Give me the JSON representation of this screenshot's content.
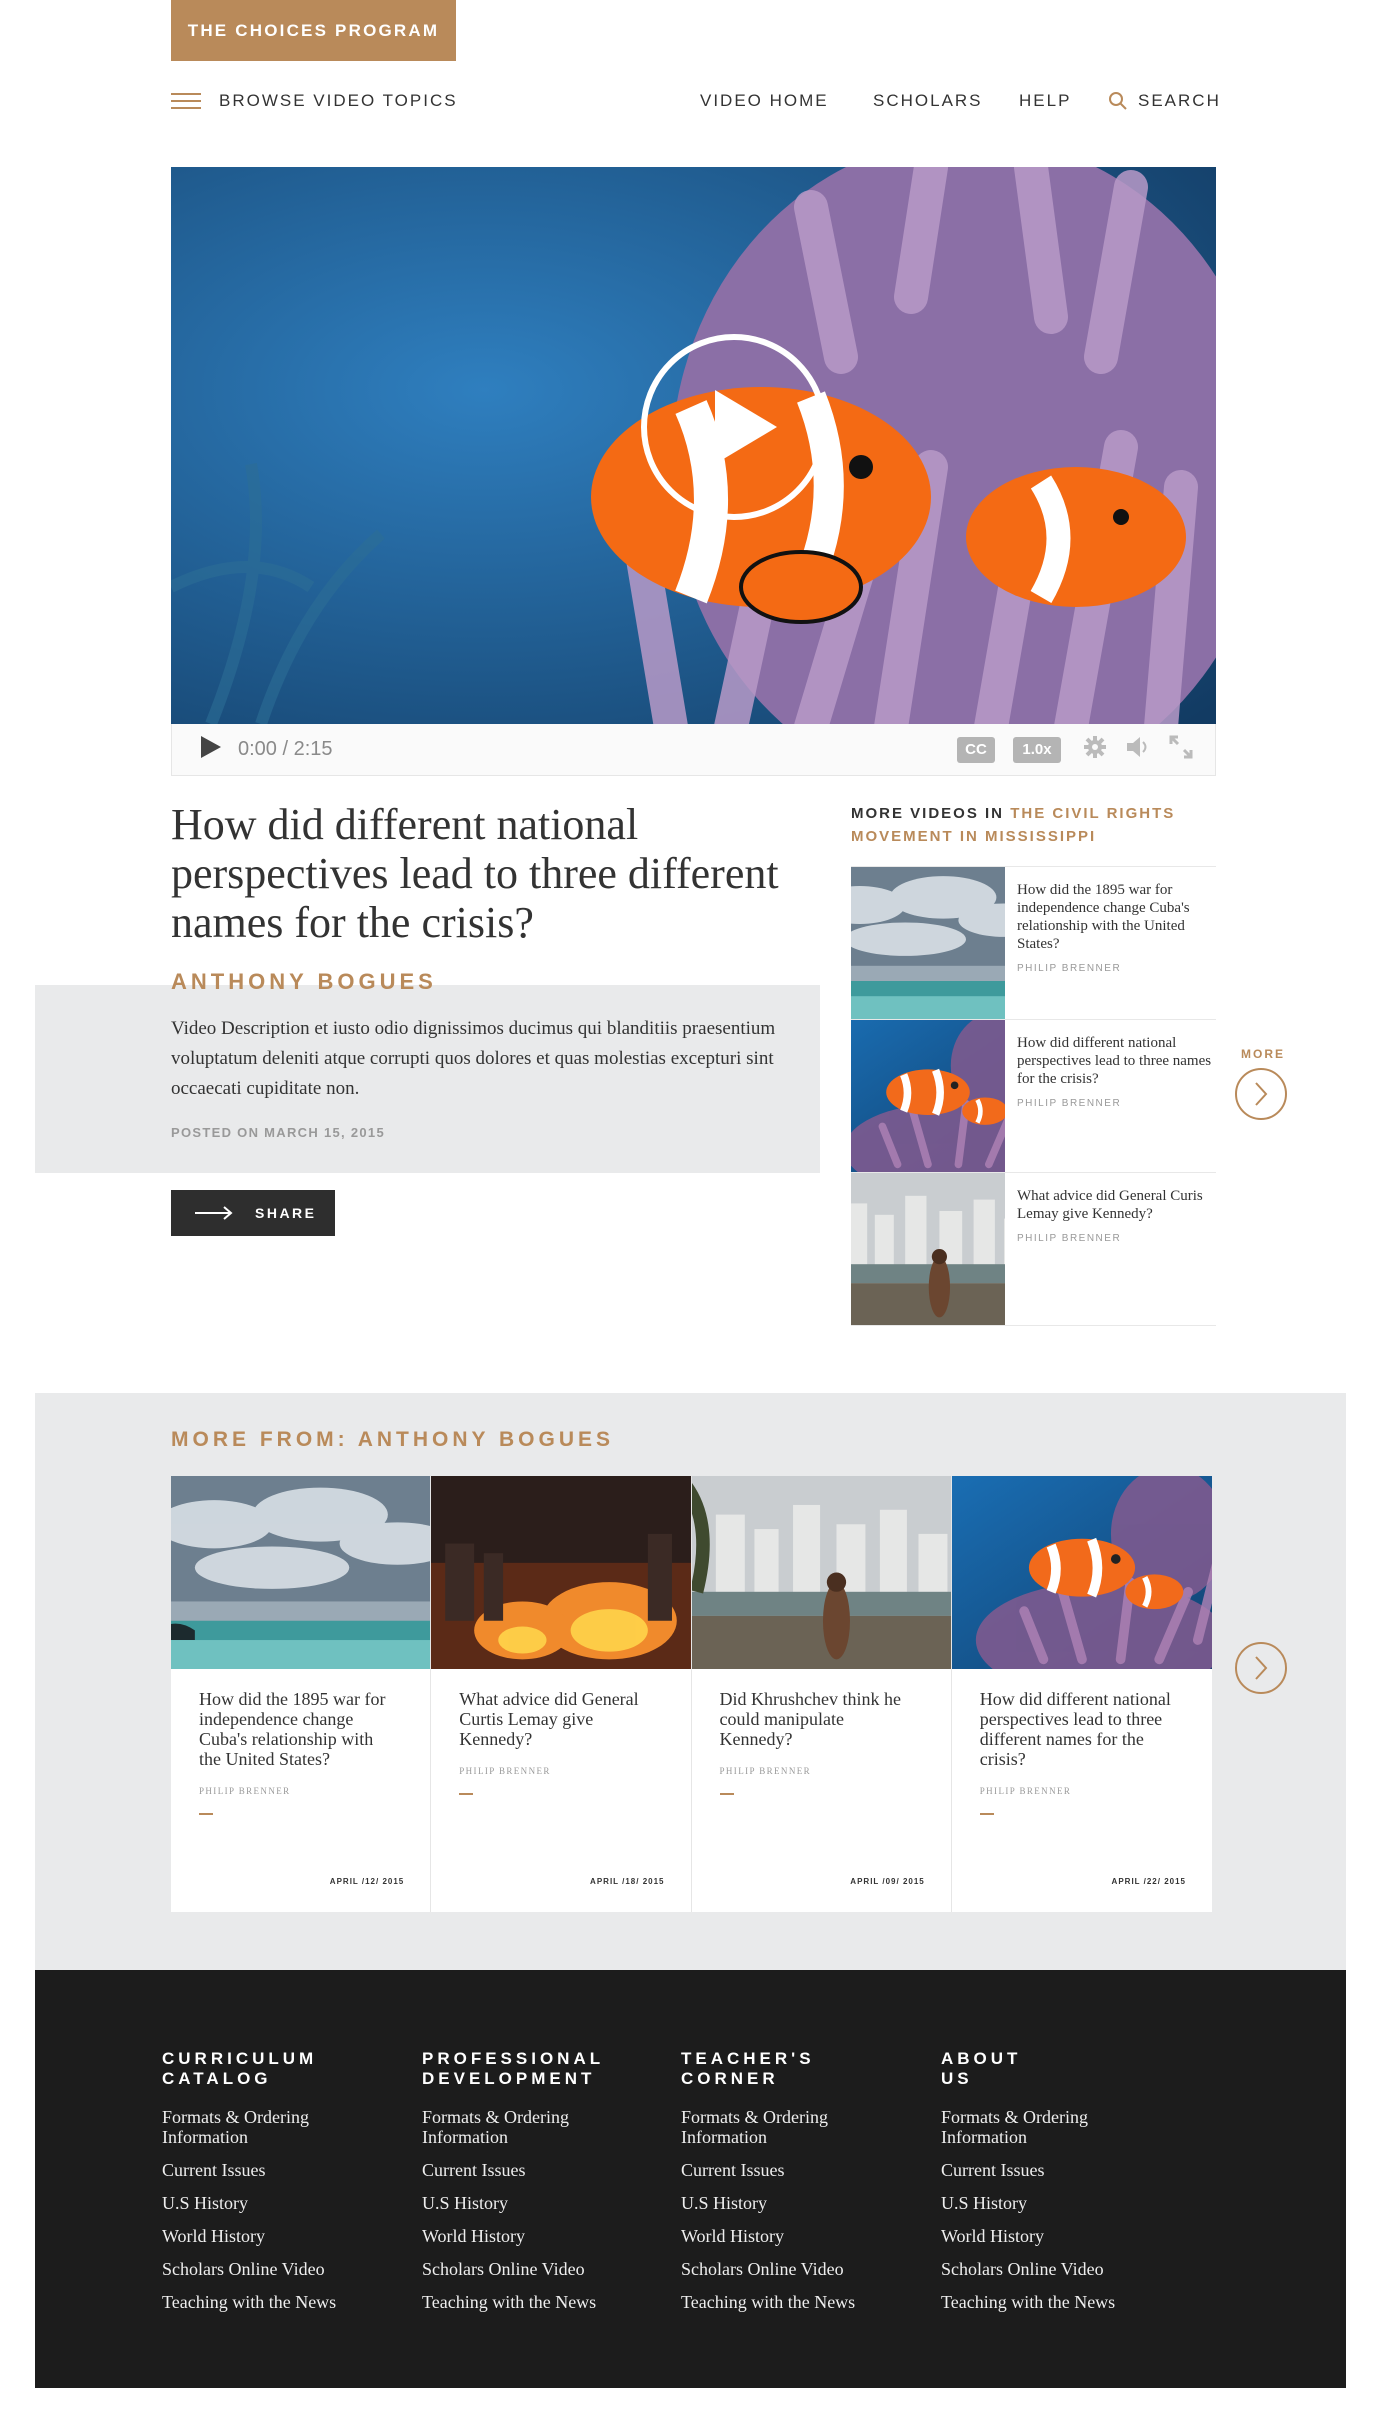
{
  "header": {
    "brand": "THE CHOICES PROGRAM",
    "browse": "BROWSE VIDEO TOPICS",
    "nav": [
      "VIDEO HOME",
      "SCHOLARS",
      "HELP"
    ],
    "search": "SEARCH"
  },
  "player": {
    "time": "0:00 / 2:15",
    "cc": "CC",
    "speed": "1.0x"
  },
  "article": {
    "title": "How did different national perspectives lead to three different names for the crisis?",
    "author": "ANTHONY BOGUES",
    "description": "Video Description et iusto odio dignissimos ducimus qui blanditiis praesentium voluptatum deleniti atque corrupti quos dolores et quas molestias excepturi sint occaecati cupiditate non.",
    "posted": "POSTED ON MARCH 15, 2015",
    "share": "SHARE"
  },
  "more_videos": {
    "prefix": "MORE VIDEOS IN",
    "topic": "THE CIVIL RIGHTS MOVEMENT IN MISSISSIPPI",
    "more_label": "MORE",
    "items": [
      {
        "title": "How did the 1895 war for independence change Cuba's relationship with the United States?",
        "author": "PHILIP BRENNER",
        "thumb": "storm"
      },
      {
        "title": "How did different national perspectives lead to three names for the crisis?",
        "author": "PHILIP BRENNER",
        "thumb": "fish"
      },
      {
        "title": "What advice did General Curis Lemay give Kennedy?",
        "author": "PHILIP BRENNER",
        "thumb": "city"
      }
    ]
  },
  "more_from": {
    "prefix": "MORE FROM:",
    "author": "ANTHONY BOGUES",
    "cards": [
      {
        "title": "How did the 1895 war for independence change Cuba's relationship with the United States?",
        "author": "PHILIP BRENNER",
        "date": "APRIL /12/ 2015",
        "thumb": "storm"
      },
      {
        "title": "What advice did General Curtis Lemay give Kennedy?",
        "author": "PHILIP BRENNER",
        "date": "APRIL /18/ 2015",
        "thumb": "fire"
      },
      {
        "title": "Did Khrushchev think he could manipulate Kennedy?",
        "author": "PHILIP BRENNER",
        "date": "APRIL /09/ 2015",
        "thumb": "city"
      },
      {
        "title": "How did different national perspectives lead to three different names for the crisis?",
        "author": "PHILIP BRENNER",
        "date": "APRIL /22/ 2015",
        "thumb": "fish"
      }
    ]
  },
  "footer": {
    "columns": [
      {
        "heading": [
          "CURRICULUM",
          "CATALOG"
        ],
        "links": [
          "Formats & Ordering Information",
          "Current Issues",
          "U.S History",
          "World History",
          "Scholars Online Video",
          "Teaching with the News"
        ]
      },
      {
        "heading": [
          "PROFESSIONAL",
          "DEVELOPMENT"
        ],
        "links": [
          "Formats & Ordering Information",
          "Current Issues",
          "U.S History",
          "World History",
          "Scholars Online Video",
          "Teaching with the News"
        ]
      },
      {
        "heading": [
          "TEACHER'S",
          "CORNER"
        ],
        "links": [
          "Formats & Ordering Information",
          "Current Issues",
          "U.S History",
          "World History",
          "Scholars Online Video",
          "Teaching with the News"
        ]
      },
      {
        "heading": [
          "ABOUT",
          "US"
        ],
        "links": [
          "Formats & Ordering Information",
          "Current Issues",
          "U.S History",
          "World History",
          "Scholars Online Video",
          "Teaching with the News"
        ]
      }
    ]
  },
  "colors": {
    "accent": "#b98a5a",
    "footer_bg": "#1c1c1c",
    "panel_bg": "#e9eaeb"
  }
}
